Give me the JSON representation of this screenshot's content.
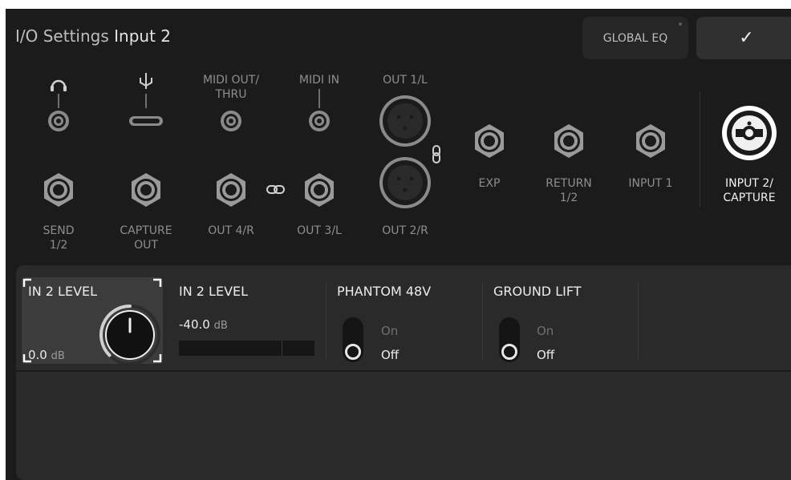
{
  "header": {
    "title": "I/O Settings",
    "subtitle": "Input 2",
    "global_eq_label": "GLOBAL EQ",
    "confirm_glyph": "✓"
  },
  "ports": {
    "midi_out": "MIDI OUT/\nTHRU",
    "midi_in": "MIDI IN",
    "out1": "OUT 1/L",
    "send": "SEND\n1/2",
    "capture_out": "CAPTURE\nOUT",
    "out4": "OUT 4/R",
    "out3": "OUT 3/L",
    "out2": "OUT 2/R",
    "exp": "EXP",
    "return": "RETURN\n1/2",
    "input1": "INPUT 1",
    "input2": "INPUT 2/\nCAPTURE"
  },
  "panel": {
    "level_card_label": "IN 2 LEVEL",
    "level_card_value": "0.0",
    "level_card_unit": "dB",
    "level_knob_fraction": 0.5,
    "meter_label": "IN 2 LEVEL",
    "meter_value": "-40.0",
    "meter_unit": "dB",
    "phantom_label": "PHANTOM 48V",
    "phantom_on": "On",
    "phantom_off": "Off",
    "ground_label": "GROUND LIFT",
    "ground_on": "On",
    "ground_off": "Off"
  },
  "icons": [
    "headphones-icon",
    "usb-icon",
    "link-icon",
    "link-vertical-icon",
    "checkmark-icon",
    "knob-icon"
  ],
  "colors": {
    "background": "#1b1b1b",
    "panel": "#2a2a2a",
    "selected_card": "#3c3c3c",
    "text": "#ececec"
  }
}
